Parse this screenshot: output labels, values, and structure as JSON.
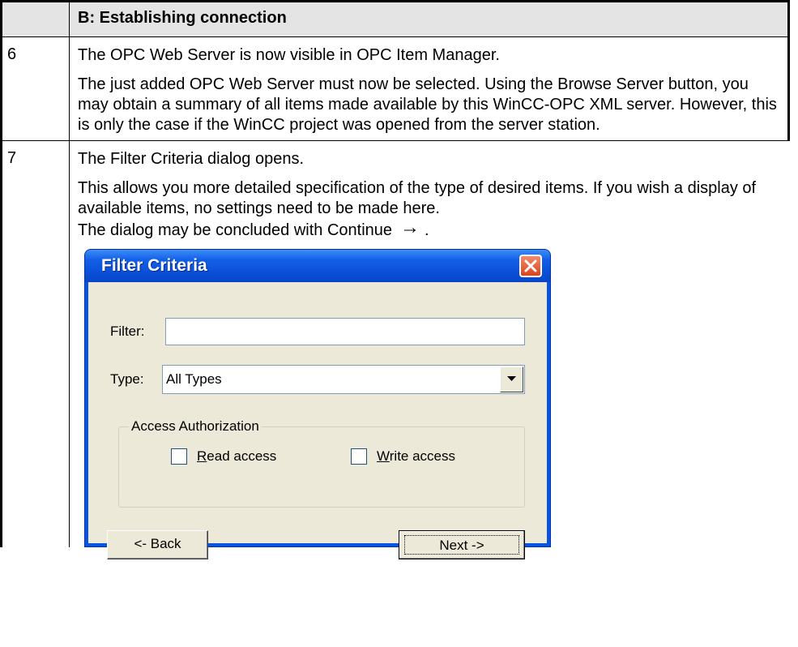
{
  "header": {
    "number": "",
    "title": "B: Establishing connection"
  },
  "steps": [
    {
      "number": "6",
      "paragraphs": [
        "The OPC Web Server is now visible in OPC Item Manager.",
        "The just added OPC Web Server must now be selected. Using the Browse Server button, you may obtain a summary of all items made available by this WinCC-OPC XML server. However, this is only the case if the WinCC project was opened from the server station."
      ]
    },
    {
      "number": "7",
      "paragraphs": [
        "The Filter Criteria dialog opens.",
        "This allows you more detailed specification of the type of desired items. If you wish a display of available items, no settings need to be made here.",
        "The dialog may be concluded with Continue"
      ],
      "continue_arrow": "→",
      "continue_suffix": "."
    }
  ],
  "dialog": {
    "title": "Filter Criteria",
    "filter_label": "Filter:",
    "filter_value": "",
    "type_label": "Type:",
    "type_value": "All Types",
    "group_label": "Access Authorization",
    "read_access_label": "Read access",
    "read_access_checked": false,
    "write_access_label": "Write access",
    "write_access_checked": false,
    "back_button": "<- Back",
    "next_button": "Next ->",
    "icons": {
      "close": "close-icon",
      "dropdown": "chevron-down-icon"
    },
    "colors": {
      "titlebar": "#0b4fd8",
      "client": "#ece9d8",
      "close": "#d9451d"
    }
  }
}
